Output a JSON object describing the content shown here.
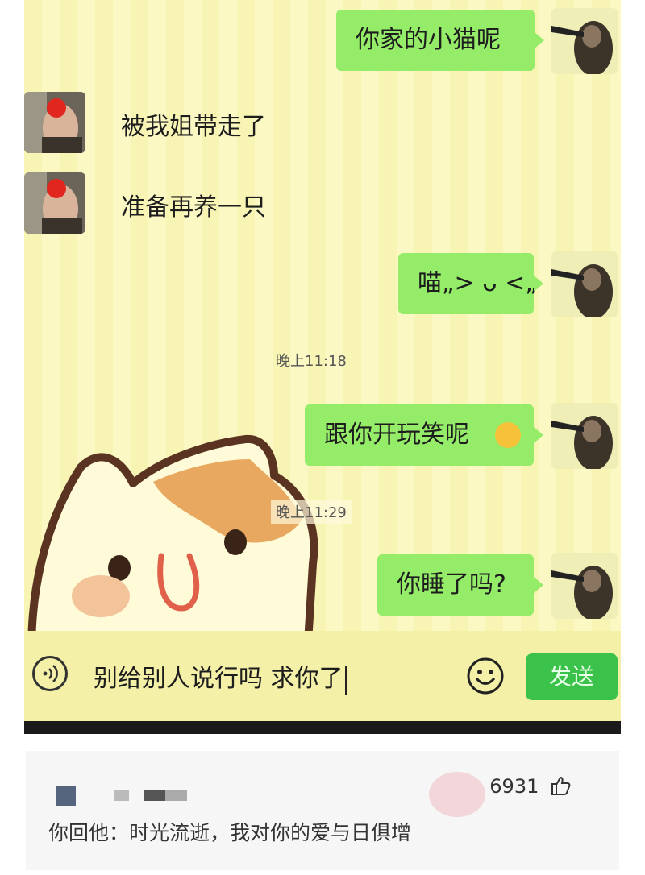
{
  "messages": {
    "m1": "你家的小猫呢",
    "m2": "被我姐带走了",
    "m3": "准备再养一只",
    "m4": "喵„> ᴗ <„",
    "m5": "跟你开玩笑呢",
    "m6": "你睡了吗?"
  },
  "timestamps": {
    "t1": "晚上11:18",
    "t2": "晚上11:29"
  },
  "input": {
    "value": "别给别人说行吗 求你了"
  },
  "buttons": {
    "send": "发送"
  },
  "icons": {
    "voice": "voice-icon",
    "emoji": "emoji-icon",
    "thumbs_up": "thumbs-up-icon"
  },
  "comment": {
    "likes": "6931",
    "text": "你回他：时光流逝，我对你的爱与日俱增"
  },
  "colors": {
    "bubble": "#95ec69",
    "send": "#3bc24a",
    "chat_bg": "#f7f4b4"
  }
}
